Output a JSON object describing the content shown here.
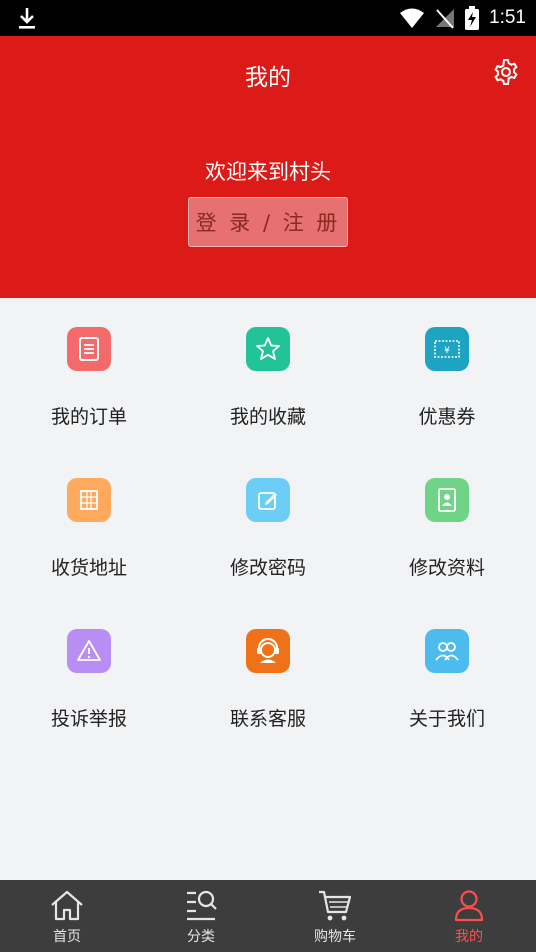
{
  "status_bar": {
    "time": "1:51"
  },
  "header": {
    "title": "我的",
    "welcome": "欢迎来到村头",
    "login_label": "登 录 / 注 册",
    "bg_color": "#dc1b18"
  },
  "menu": {
    "items": [
      {
        "label": "我的订单",
        "icon": "order-icon",
        "color": "#f46a6a"
      },
      {
        "label": "我的收藏",
        "icon": "star-icon",
        "color": "#23c39a"
      },
      {
        "label": "优惠券",
        "icon": "coupon-icon",
        "color": "#1fa3c2"
      },
      {
        "label": "收货地址",
        "icon": "address-icon",
        "color": "#ffa95f"
      },
      {
        "label": "修改密码",
        "icon": "edit-icon",
        "color": "#6ccdf7"
      },
      {
        "label": "修改资料",
        "icon": "profile-card-icon",
        "color": "#6fd388"
      },
      {
        "label": "投诉举报",
        "icon": "warning-icon",
        "color": "#b88ef5"
      },
      {
        "label": "联系客服",
        "icon": "headset-icon",
        "color": "#f07218"
      },
      {
        "label": "关于我们",
        "icon": "team-icon",
        "color": "#4cbcef"
      }
    ]
  },
  "tabbar": {
    "tabs": [
      {
        "label": "首页",
        "icon": "home-icon"
      },
      {
        "label": "分类",
        "icon": "category-search-icon"
      },
      {
        "label": "购物车",
        "icon": "cart-icon"
      },
      {
        "label": "我的",
        "icon": "user-icon",
        "active": true
      }
    ],
    "active_color": "#ff4d4d"
  }
}
